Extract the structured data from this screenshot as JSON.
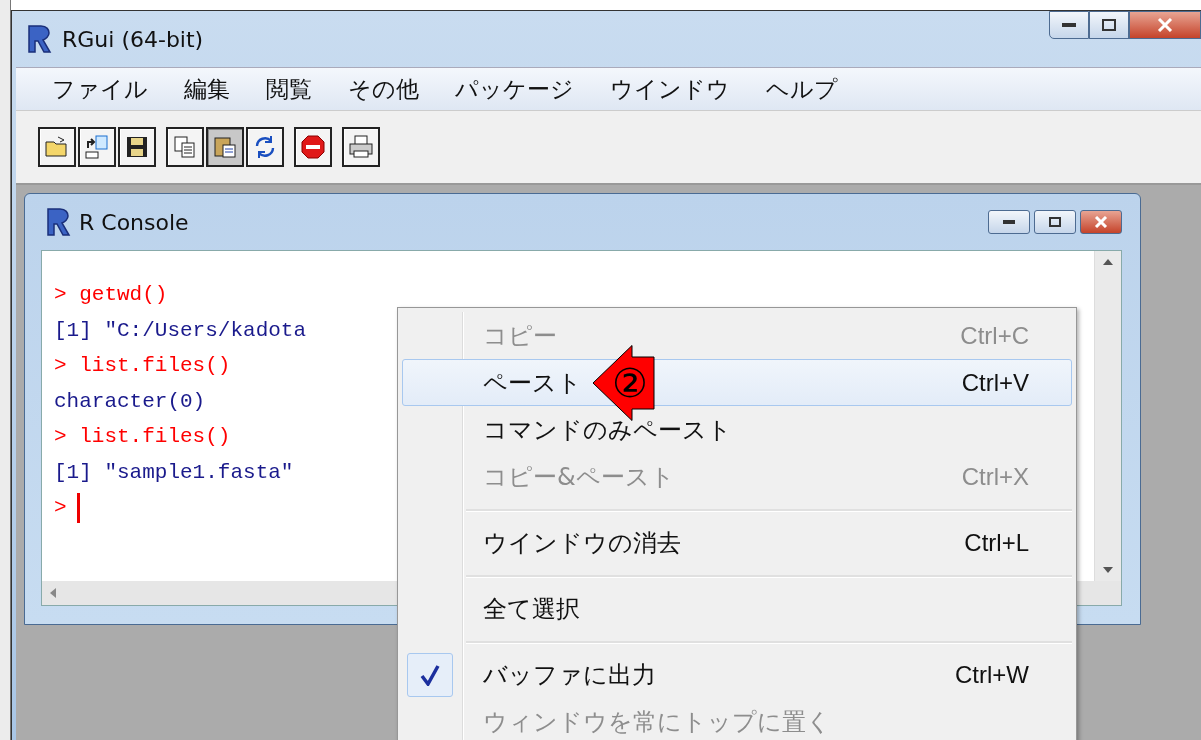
{
  "window": {
    "title": "RGui (64-bit)"
  },
  "menu_bar": [
    "ファイル",
    "編集",
    "閲覧",
    "その他",
    "パッケージ",
    "ウインドウ",
    "ヘルプ"
  ],
  "toolbar": [
    [
      {
        "kind": "open",
        "pressed": false
      },
      {
        "kind": "load",
        "pressed": false
      },
      {
        "kind": "save",
        "pressed": false
      }
    ],
    [
      {
        "kind": "copy",
        "pressed": false
      },
      {
        "kind": "paste",
        "pressed": true
      },
      {
        "kind": "refresh",
        "pressed": false
      }
    ],
    [
      {
        "kind": "stop",
        "pressed": false
      }
    ],
    [
      {
        "kind": "print",
        "pressed": false
      }
    ]
  ],
  "console": {
    "title": "R Console",
    "lines": [
      {
        "kind": "prompt",
        "text": "> getwd()"
      },
      {
        "kind": "output",
        "text": "[1] \"C:/Users/kadota"
      },
      {
        "kind": "prompt",
        "text": "> list.files()"
      },
      {
        "kind": "output",
        "text": "character(0)"
      },
      {
        "kind": "prompt",
        "text": "> list.files()"
      },
      {
        "kind": "output",
        "text": "[1] \"sample1.fasta\""
      },
      {
        "kind": "input",
        "text": ">"
      }
    ]
  },
  "context_menu": [
    {
      "kind": "item",
      "label": "コピー",
      "shortcut": "Ctrl+C",
      "disabled": true,
      "selected": false,
      "checked": false
    },
    {
      "kind": "item",
      "label": "ペースト",
      "shortcut": "Ctrl+V",
      "disabled": false,
      "selected": true,
      "checked": false
    },
    {
      "kind": "item",
      "label": "コマンドのみペースト",
      "disabled": false,
      "selected": false,
      "checked": false
    },
    {
      "kind": "item",
      "label": "コピー&ペースト",
      "shortcut": "Ctrl+X",
      "disabled": true,
      "selected": false,
      "checked": false
    },
    {
      "kind": "separator"
    },
    {
      "kind": "item",
      "label": "ウインドウの消去",
      "shortcut": "Ctrl+L",
      "disabled": false,
      "selected": false,
      "checked": false
    },
    {
      "kind": "separator"
    },
    {
      "kind": "item",
      "label": "全て選択",
      "disabled": false,
      "selected": false,
      "checked": false
    },
    {
      "kind": "separator"
    },
    {
      "kind": "item",
      "label": "バッファに出力",
      "shortcut": "Ctrl+W",
      "disabled": false,
      "selected": false,
      "checked": true
    },
    {
      "kind": "item",
      "label": "ウィンドウを常にトップに置く",
      "disabled": true,
      "selected": false,
      "checked": false
    }
  ],
  "annotation": {
    "label": "②"
  }
}
